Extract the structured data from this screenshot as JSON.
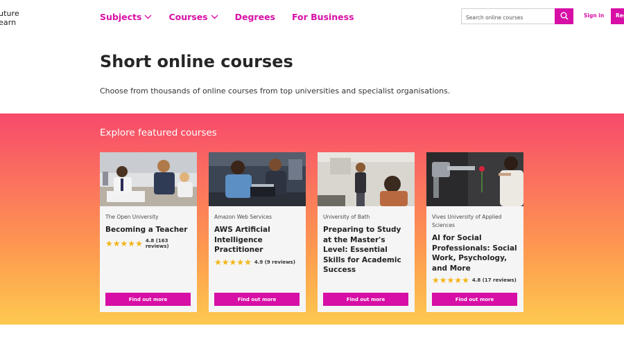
{
  "header": {
    "logo_line1": "uture",
    "logo_line2": "earn",
    "nav": [
      {
        "label": "Subjects",
        "has_dropdown": true
      },
      {
        "label": "Courses",
        "has_dropdown": true
      },
      {
        "label": "Degrees",
        "has_dropdown": false
      },
      {
        "label": "For Business",
        "has_dropdown": false
      }
    ],
    "search": {
      "placeholder": "Search online courses",
      "value": ""
    },
    "signin_label": "Sign in",
    "register_label": "Reg"
  },
  "intro": {
    "title": "Short online courses",
    "subtitle": "Choose from thousands of online courses from top universities and specialist organisations."
  },
  "featured": {
    "title": "Explore featured courses",
    "courses": [
      {
        "provider": "The Open University",
        "title": "Becoming a Teacher",
        "rating": "4.8",
        "reviews": "(163 reviews)",
        "stars": 5,
        "button": "Find out more"
      },
      {
        "provider": "Amazon Web Services",
        "title": "AWS Artificial Intelligence Practitioner",
        "rating": "4.9",
        "reviews": "(9 reviews)",
        "stars": 5,
        "button": "Find out more"
      },
      {
        "provider": "University of Bath",
        "title": "Preparing to Study at the Master's Level: Essential Skills for Academic Success",
        "rating": "",
        "reviews": "",
        "stars": 0,
        "button": "Find out more"
      },
      {
        "provider": "Vives University of Applied Sciences",
        "title": "AI for Social Professionals: Social Work, Psychology, and More",
        "rating": "4.8",
        "reviews": "(17 reviews)",
        "stars": 5,
        "button": "Find out more"
      }
    ]
  },
  "colors": {
    "brand": "#d70fa6",
    "star": "#f3b515"
  },
  "icons": {
    "search": "search-icon",
    "dropdown": "chevron-down-icon",
    "star": "star-icon"
  }
}
